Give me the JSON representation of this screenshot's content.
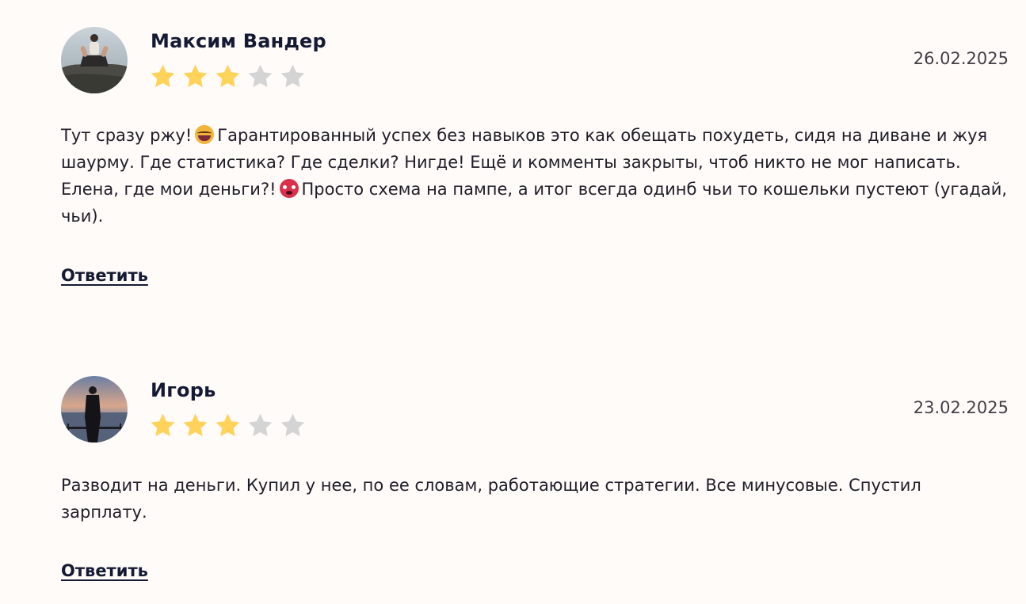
{
  "reviews": [
    {
      "author": "Максим Вандер",
      "date": "26.02.2025",
      "rating": 3,
      "rating_max": 5,
      "text_parts": [
        "Тут сразу ржу!",
        "Гарантированный успех без навыков это как обещать похудеть, сидя на диване и жуя шаурму. Где статистика? Где сделки? Нигде! Ещё и комменты закрыты, чтоб никто не мог написать. Елена, где мои деньги?!",
        "Просто схема на пампе, а итог всегда одинб чьи то кошельки пустеют (угадай, чьи)."
      ],
      "emojis": [
        "laughing-emoji",
        "angry-emoji"
      ],
      "reply_label": "Ответить"
    },
    {
      "author": "Игорь",
      "date": "23.02.2025",
      "rating": 3,
      "rating_max": 5,
      "text": "Разводит на деньги. Купил у нее, по ее словам, работающие стратегии. Все минусовые. Спустил зарплату.",
      "reply_label": "Ответить"
    }
  ],
  "colors": {
    "background": "#fffbf8",
    "star_filled": "#ffd25a",
    "star_empty": "#d4d4d4",
    "author": "#141a33",
    "date": "#3f3f46"
  }
}
